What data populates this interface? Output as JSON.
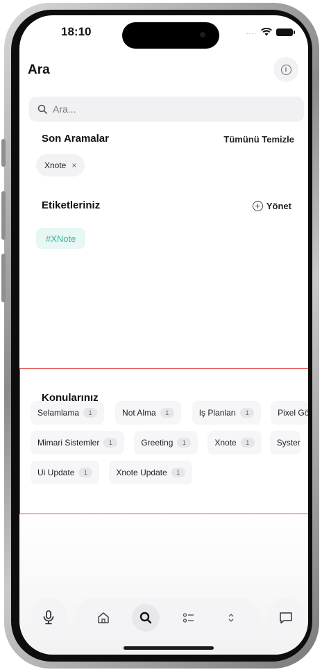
{
  "status_bar": {
    "time": "18:10",
    "signal": "...."
  },
  "header": {
    "title": "Ara"
  },
  "search": {
    "placeholder": "Ara..."
  },
  "recent": {
    "title": "Son Aramalar",
    "clear_label": "Tümünü Temizle",
    "items": [
      "Xnote"
    ]
  },
  "tags": {
    "title": "Etiketleriniz",
    "manage_label": "Yönet",
    "items": [
      "#XNote"
    ]
  },
  "topics": {
    "title": "Konularınız",
    "rows": [
      [
        {
          "label": "Selamlama",
          "count": "1"
        },
        {
          "label": "Not Alma",
          "count": "1"
        },
        {
          "label": "Iş Planları",
          "count": "1"
        },
        {
          "label": "Pixel Gö",
          "count": ""
        }
      ],
      [
        {
          "label": "Mimari Sistemler",
          "count": "1"
        },
        {
          "label": "Greeting",
          "count": "1"
        },
        {
          "label": "Xnote",
          "count": "1"
        },
        {
          "label": "Syster",
          "count": ""
        }
      ],
      [
        {
          "label": "Ui Update",
          "count": "1"
        },
        {
          "label": "Xnote Update",
          "count": "1"
        }
      ]
    ]
  },
  "colors": {
    "accent_tag_bg": "#e6f7f4",
    "accent_tag_text": "#36b8a1",
    "highlight_border": "#e04545"
  },
  "nav": {
    "icons": [
      "microphone-icon",
      "home-icon",
      "search-icon",
      "checklist-icon",
      "chevron-updown-icon",
      "chat-icon"
    ],
    "active": "search-icon"
  }
}
